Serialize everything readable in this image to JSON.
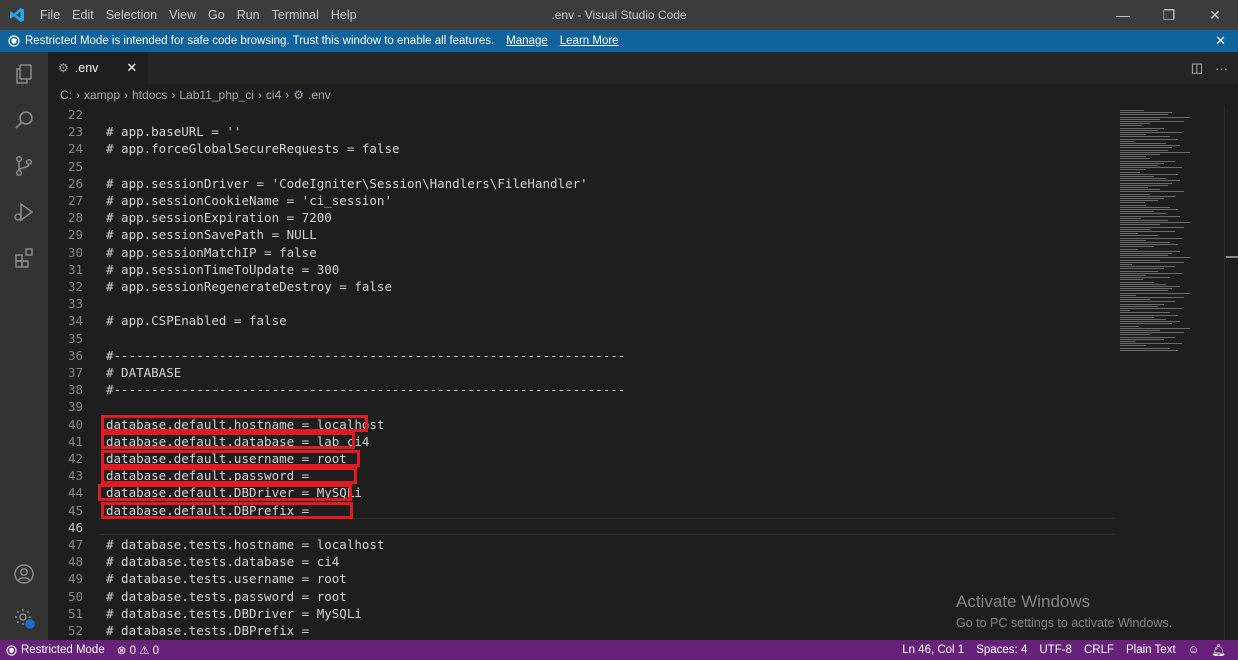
{
  "titlebar": {
    "menu": [
      "File",
      "Edit",
      "Selection",
      "View",
      "Go",
      "Run",
      "Terminal",
      "Help"
    ],
    "title": ".env - Visual Studio Code",
    "minimize": "—",
    "maximize": "❐",
    "close": "✕"
  },
  "banner": {
    "text": "Restricted Mode is intended for safe code browsing. Trust this window to enable all features.",
    "manage": "Manage",
    "learn_more": "Learn More",
    "close": "✕"
  },
  "tab": {
    "label": ".env",
    "close": "✕"
  },
  "breadcrumb": [
    "C:",
    "xampp",
    "htdocs",
    "Lab11_php_ci",
    "ci4",
    ".env"
  ],
  "editor": {
    "lines": [
      {
        "n": "22",
        "t": ""
      },
      {
        "n": "23",
        "t": "# app.baseURL = ''"
      },
      {
        "n": "24",
        "t": "# app.forceGlobalSecureRequests = false"
      },
      {
        "n": "25",
        "t": ""
      },
      {
        "n": "26",
        "t": "# app.sessionDriver = 'CodeIgniter\\Session\\Handlers\\FileHandler'"
      },
      {
        "n": "27",
        "t": "# app.sessionCookieName = 'ci_session'"
      },
      {
        "n": "28",
        "t": "# app.sessionExpiration = 7200"
      },
      {
        "n": "29",
        "t": "# app.sessionSavePath = NULL"
      },
      {
        "n": "30",
        "t": "# app.sessionMatchIP = false"
      },
      {
        "n": "31",
        "t": "# app.sessionTimeToUpdate = 300"
      },
      {
        "n": "32",
        "t": "# app.sessionRegenerateDestroy = false"
      },
      {
        "n": "33",
        "t": ""
      },
      {
        "n": "34",
        "t": "# app.CSPEnabled = false"
      },
      {
        "n": "35",
        "t": ""
      },
      {
        "n": "36",
        "t": "#--------------------------------------------------------------------"
      },
      {
        "n": "37",
        "t": "# DATABASE"
      },
      {
        "n": "38",
        "t": "#--------------------------------------------------------------------"
      },
      {
        "n": "39",
        "t": ""
      },
      {
        "n": "40",
        "t": "database.default.hostname = localhost"
      },
      {
        "n": "41",
        "t": "database.default.database = lab_ci4"
      },
      {
        "n": "42",
        "t": "database.default.username = root"
      },
      {
        "n": "43",
        "t": "database.default.password ="
      },
      {
        "n": "44",
        "t": "database.default.DBDriver = MySQLi"
      },
      {
        "n": "45",
        "t": "database.default.DBPrefix ="
      },
      {
        "n": "46",
        "t": ""
      },
      {
        "n": "47",
        "t": "# database.tests.hostname = localhost"
      },
      {
        "n": "48",
        "t": "# database.tests.database = ci4"
      },
      {
        "n": "49",
        "t": "# database.tests.username = root"
      },
      {
        "n": "50",
        "t": "# database.tests.password = root"
      },
      {
        "n": "51",
        "t": "# database.tests.DBDriver = MySQLi"
      },
      {
        "n": "52",
        "t": "# database.tests.DBPrefix ="
      }
    ],
    "active_line": "46"
  },
  "watermark": {
    "line1": "Activate Windows",
    "line2": "Go to PC settings to activate Windows."
  },
  "statusbar": {
    "restricted": "Restricted Mode",
    "errors": "⊗ 0 ⚠ 0",
    "position": "Ln 46, Col 1",
    "spaces": "Spaces: 4",
    "encoding": "UTF-8",
    "eol": "CRLF",
    "language": "Plain Text"
  },
  "colors": {
    "banner": "#0e639c",
    "statusbar": "#68217a",
    "highlight": "#e11b22"
  }
}
